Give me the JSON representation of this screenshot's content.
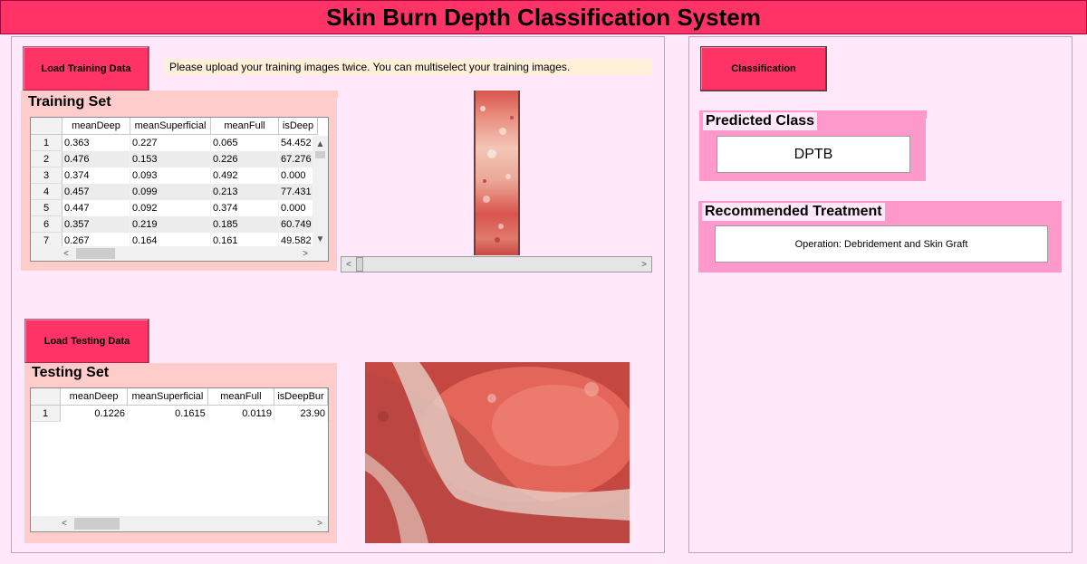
{
  "app": {
    "title": "Skin Burn Depth Classification System"
  },
  "training": {
    "load_button": "Load Training Data",
    "notice": "Please upload your training images twice. You can multiselect your training images.",
    "group_title": "Training Set",
    "columns": [
      "meanDeep",
      "meanSuperficial",
      "meanFull",
      "isDeep"
    ],
    "rows": [
      [
        "1",
        "0.363",
        "0.227",
        "0.065",
        "54.452"
      ],
      [
        "2",
        "0.476",
        "0.153",
        "0.226",
        "67.276"
      ],
      [
        "3",
        "0.374",
        "0.093",
        "0.492",
        "0.000"
      ],
      [
        "4",
        "0.457",
        "0.099",
        "0.213",
        "77.431"
      ],
      [
        "5",
        "0.447",
        "0.092",
        "0.374",
        "0.000"
      ],
      [
        "6",
        "0.357",
        "0.219",
        "0.185",
        "60.749"
      ],
      [
        "7",
        "0.267",
        "0.164",
        "0.161",
        "49.582"
      ]
    ]
  },
  "testing": {
    "load_button": "Load Testing Data",
    "group_title": "Testing Set",
    "columns": [
      "meanDeep",
      "meanSuperficial",
      "meanFull",
      "isDeepBur"
    ],
    "rows": [
      [
        "1",
        "0.1226",
        "0.1615",
        "0.0119",
        "23.90"
      ]
    ]
  },
  "classification": {
    "button": "Classification",
    "predicted_title": "Predicted Class",
    "predicted_value": "DPTB",
    "treatment_title": "Recommended Treatment",
    "treatment_value": "Operation: Debridement and Skin Graft"
  },
  "icons": {
    "scroll_up": "▲",
    "scroll_down": "▼",
    "scroll_left": "<",
    "scroll_right": ">"
  },
  "colors": {
    "title_bar": "#ff3366",
    "button": "#ff3366",
    "background": "#ffe8fa",
    "group_box": "#ffcccc",
    "result_box": "#ff99cc"
  }
}
